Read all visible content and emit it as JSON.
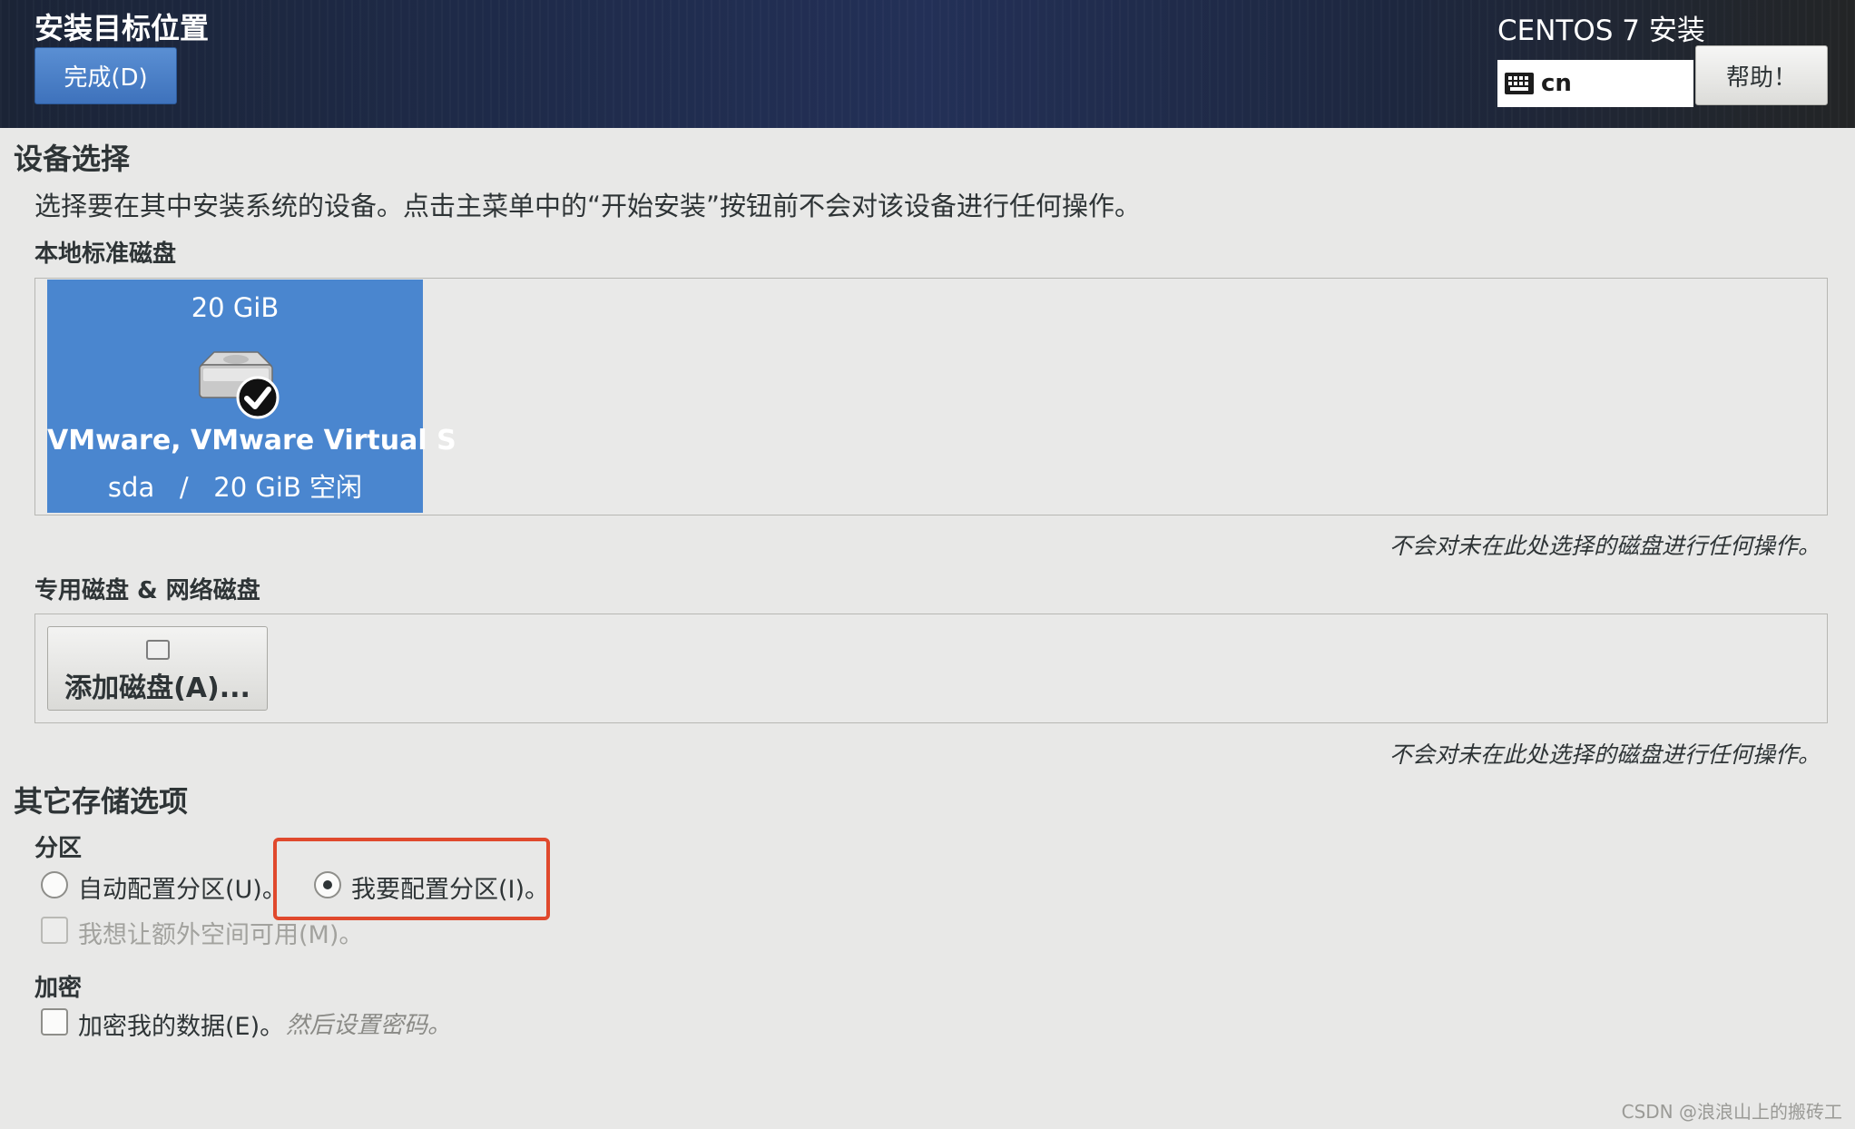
{
  "header": {
    "spoke_title": "安装目标位置",
    "done_button": "完成(D)",
    "product_title": "CENTOS 7 安装",
    "keyboard_layout": "cn",
    "help_button": "帮助！"
  },
  "device_selection": {
    "heading": "设备选择",
    "description": "选择要在其中安装系统的设备。点击主菜单中的“开始安装”按钮前不会对该设备进行任何操作。",
    "local_disks": {
      "heading": "本地标准磁盘",
      "disks": [
        {
          "size": "20 GiB",
          "name": "VMware, VMware Virtual S",
          "info": "sda   /   20 GiB 空闲",
          "selected": true,
          "icon": "hard-disk-checked-icon"
        }
      ],
      "note": "不会对未在此处选择的磁盘进行任何操作。"
    },
    "specialized_disks": {
      "heading": "专用磁盘 & 网络磁盘",
      "add_button": "添加磁盘(A)...",
      "note": "不会对未在此处选择的磁盘进行任何操作。"
    }
  },
  "other_storage": {
    "heading": "其它存储选项",
    "partitioning": {
      "heading": "分区",
      "auto_option": "自动配置分区(U)。",
      "manual_option": "我要配置分区(I)。",
      "selected": "manual",
      "extra_space_option": "我想让额外空间可用(M)。"
    },
    "encryption": {
      "heading": "加密",
      "encrypt_option": "加密我的数据(E)。",
      "hint": "然后设置密码。"
    }
  },
  "watermark": "CSDN @浪浪山上的搬砖工",
  "colors": {
    "accent": "#4a86cf",
    "highlight_box": "#e0492d",
    "background": "#e8e8e7"
  }
}
